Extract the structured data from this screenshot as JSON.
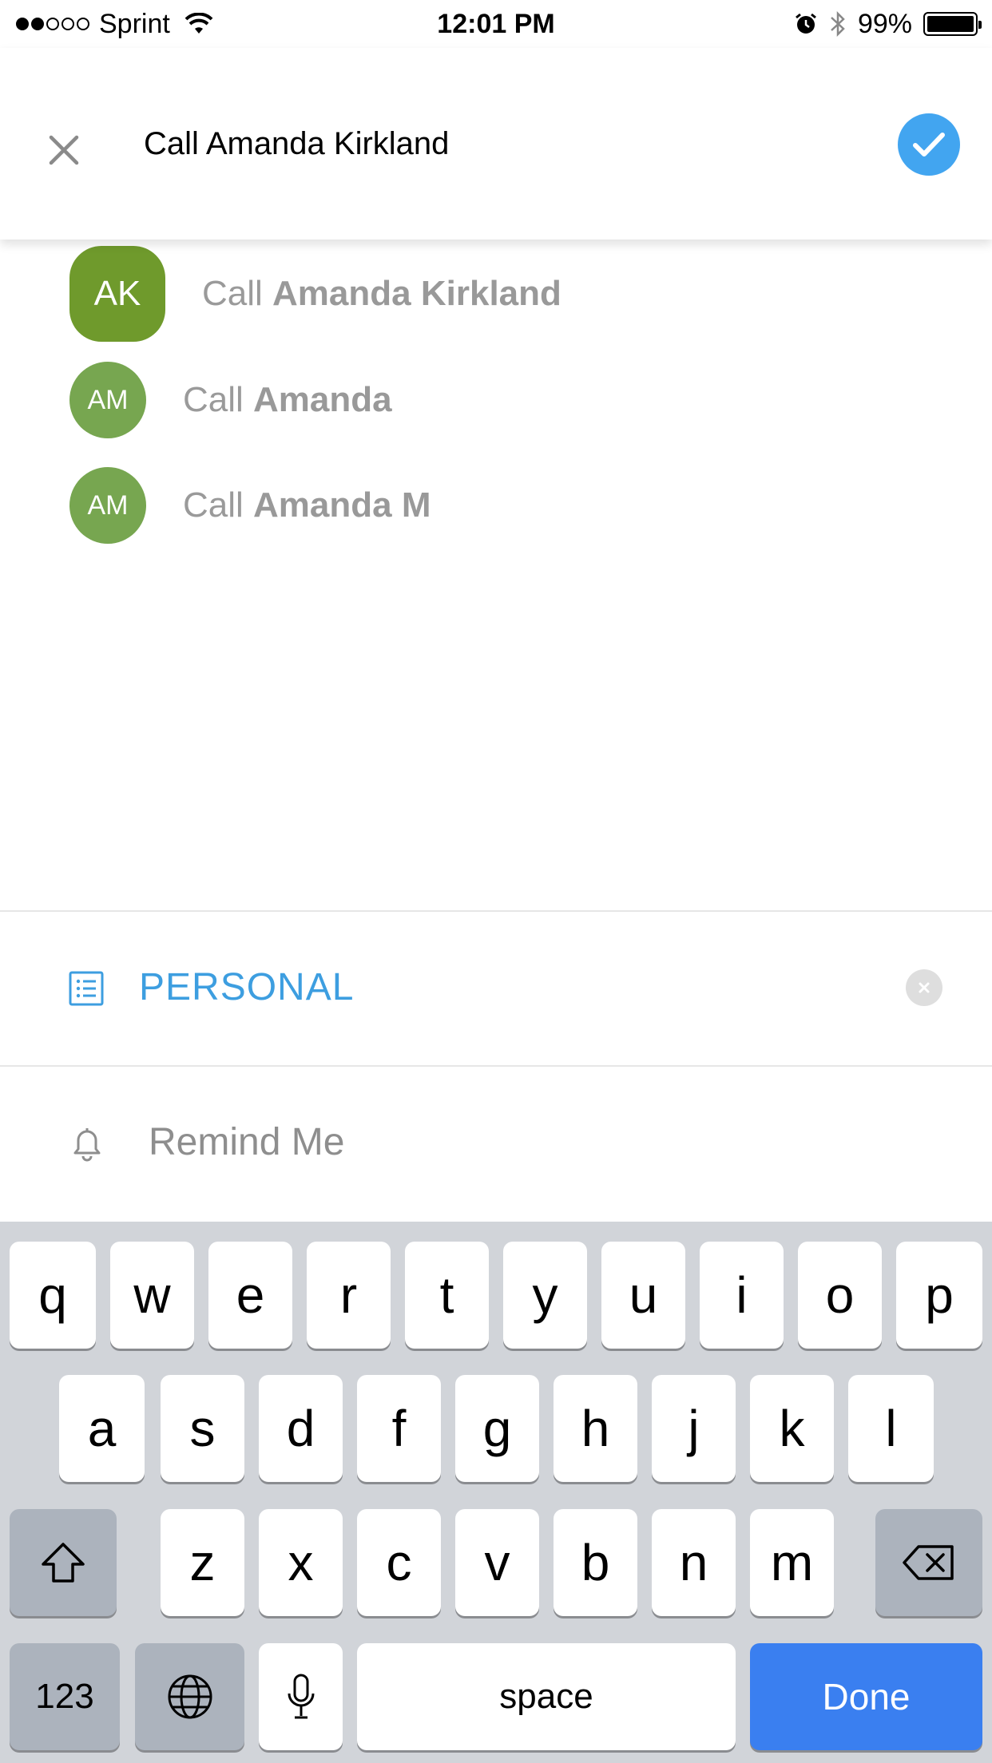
{
  "status_bar": {
    "carrier": "Sprint",
    "time": "12:01 PM",
    "battery": "99%",
    "signal_bars_filled": 2,
    "signal_bars_total": 5
  },
  "header": {
    "task_value": "Call Amanda Kirkland",
    "close_icon": "close-icon",
    "confirm_icon": "checkmark-icon",
    "accent_color": "#42a5f0"
  },
  "suggestions": [
    {
      "initials": "AK",
      "prefix": "Call",
      "name": "Amanda Kirkland"
    },
    {
      "initials": "AM",
      "prefix": "Call",
      "name": "Amanda"
    },
    {
      "initials": "AM",
      "prefix": "Call",
      "name": "Amanda M"
    }
  ],
  "list_row": {
    "label": "PERSONAL",
    "icon": "list-icon",
    "color": "#3d9ee0"
  },
  "remind_row": {
    "label": "Remind Me",
    "icon": "bell-icon"
  },
  "keyboard": {
    "row1": [
      "q",
      "w",
      "e",
      "r",
      "t",
      "y",
      "u",
      "i",
      "o",
      "p"
    ],
    "row2": [
      "a",
      "s",
      "d",
      "f",
      "g",
      "h",
      "j",
      "k",
      "l"
    ],
    "row3": [
      "z",
      "x",
      "c",
      "v",
      "b",
      "n",
      "m"
    ],
    "numbers_label": "123",
    "space_label": "space",
    "done_label": "Done",
    "done_color": "#3a7ff0"
  }
}
